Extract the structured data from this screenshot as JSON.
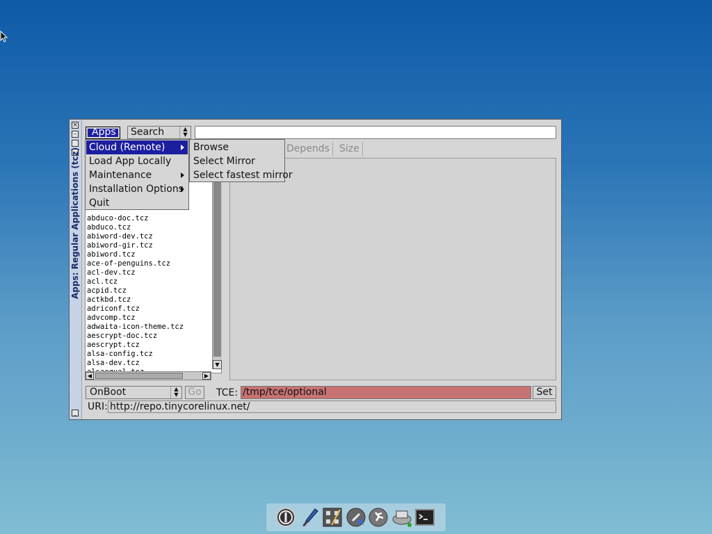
{
  "window": {
    "title": "Apps: Regular Applications (tcz)"
  },
  "toolbar": {
    "apps_label": "Apps",
    "search_mode": "Search",
    "search_value": ""
  },
  "tabs": [
    {
      "label": "Depends"
    },
    {
      "label": "Size"
    }
  ],
  "app_list": [
    "abduco-doc.tcz",
    "abduco.tcz",
    "abiword-dev.tcz",
    "abiword-gir.tcz",
    "abiword.tcz",
    "ace-of-penguins.tcz",
    "acl-dev.tcz",
    "acl.tcz",
    "acpid.tcz",
    "actkbd.tcz",
    "adriconf.tcz",
    "advcomp.tcz",
    "adwaita-icon-theme.tcz",
    "aescrypt-doc.tcz",
    "aescrypt.tcz",
    "alsa-config.tcz",
    "alsa-dev.tcz",
    "alsaequal.tcz"
  ],
  "apps_menu": {
    "items": [
      {
        "label": "Cloud (Remote)",
        "submenu": true,
        "selected": true
      },
      {
        "label": "Load App Locally",
        "submenu": false
      },
      {
        "label": "Maintenance",
        "submenu": true
      },
      {
        "label": "Installation Options",
        "submenu": true
      },
      {
        "label": "Quit",
        "submenu": false
      }
    ]
  },
  "cloud_submenu": {
    "items": [
      {
        "label": "Browse"
      },
      {
        "label": "Select Mirror"
      },
      {
        "label": "Select fastest mirror"
      }
    ]
  },
  "bottom": {
    "install_mode": "OnBoot",
    "go_label": "Go",
    "tce_label": "TCE:",
    "tce_path": "/tmp/tce/optional",
    "set_label": "Set",
    "uri_label": "URI:",
    "uri_value": "http://repo.tinycorelinux.net/"
  },
  "colors": {
    "menu_highlight": "#1c1ea0",
    "tce_field": "#c87373"
  }
}
